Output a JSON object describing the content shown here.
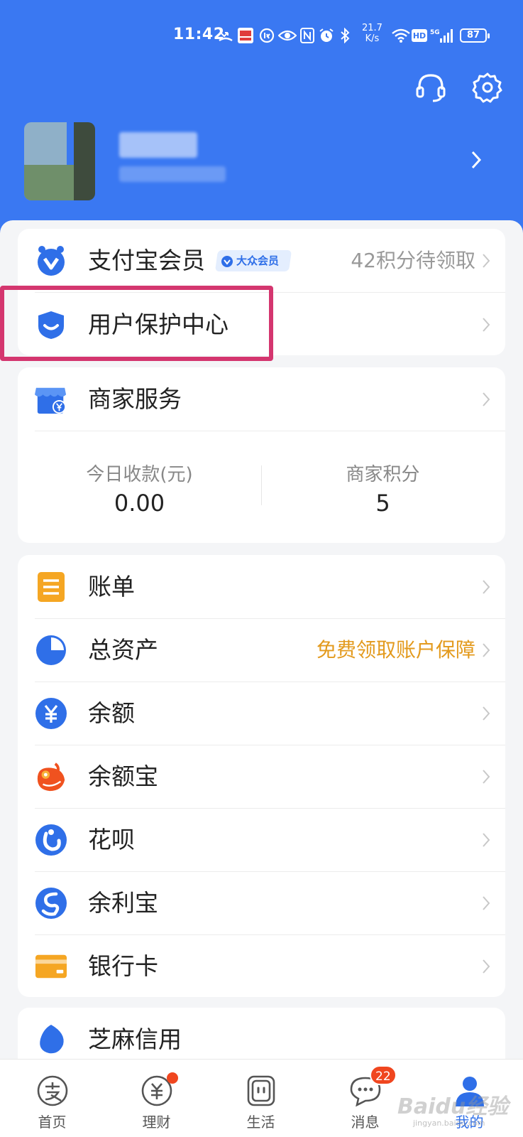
{
  "status_bar": {
    "time": "11:42",
    "network_speed_value": "21.7",
    "network_speed_unit": "K/s",
    "battery": "87",
    "signal": "5G",
    "hd": "HD"
  },
  "header": {
    "icons": [
      "headset-icon",
      "settings-icon"
    ]
  },
  "member_card": {
    "member": {
      "label": "支付宝会员",
      "badge": "大众会员",
      "right": "42积分待领取"
    },
    "protection": {
      "label": "用户保护中心"
    }
  },
  "merchant_card": {
    "label": "商家服务",
    "stats": [
      {
        "title": "今日收款(元)",
        "value": "0.00"
      },
      {
        "title": "商家积分",
        "value": "5"
      }
    ]
  },
  "menu": [
    {
      "label": "账单",
      "icon": "bill-icon",
      "right": ""
    },
    {
      "label": "总资产",
      "icon": "pie-chart-icon",
      "right": "免费领取账户保障"
    },
    {
      "label": "余额",
      "icon": "yuan-icon",
      "right": ""
    },
    {
      "label": "余额宝",
      "icon": "yuebao-icon",
      "right": ""
    },
    {
      "label": "花呗",
      "icon": "huabei-icon",
      "right": ""
    },
    {
      "label": "余利宝",
      "icon": "yulibao-icon",
      "right": ""
    },
    {
      "label": "银行卡",
      "icon": "bank-card-icon",
      "right": ""
    }
  ],
  "partial_row": {
    "label": "芝麻信用"
  },
  "tabbar": {
    "tabs": [
      {
        "label": "首页",
        "icon": "alipay-home-icon"
      },
      {
        "label": "理财",
        "icon": "wealth-icon"
      },
      {
        "label": "生活",
        "icon": "life-icon"
      },
      {
        "label": "消息",
        "icon": "message-icon",
        "badge": "22"
      },
      {
        "label": "我的",
        "icon": "profile-icon"
      }
    ]
  },
  "watermark": {
    "text": "Baidu经验",
    "sub": "jingyan.baidu.com"
  },
  "colors": {
    "brand": "#3a78f2",
    "highlight": "#d4366f",
    "accent_orange": "#e39a1d",
    "badge_red": "#f0461f"
  }
}
